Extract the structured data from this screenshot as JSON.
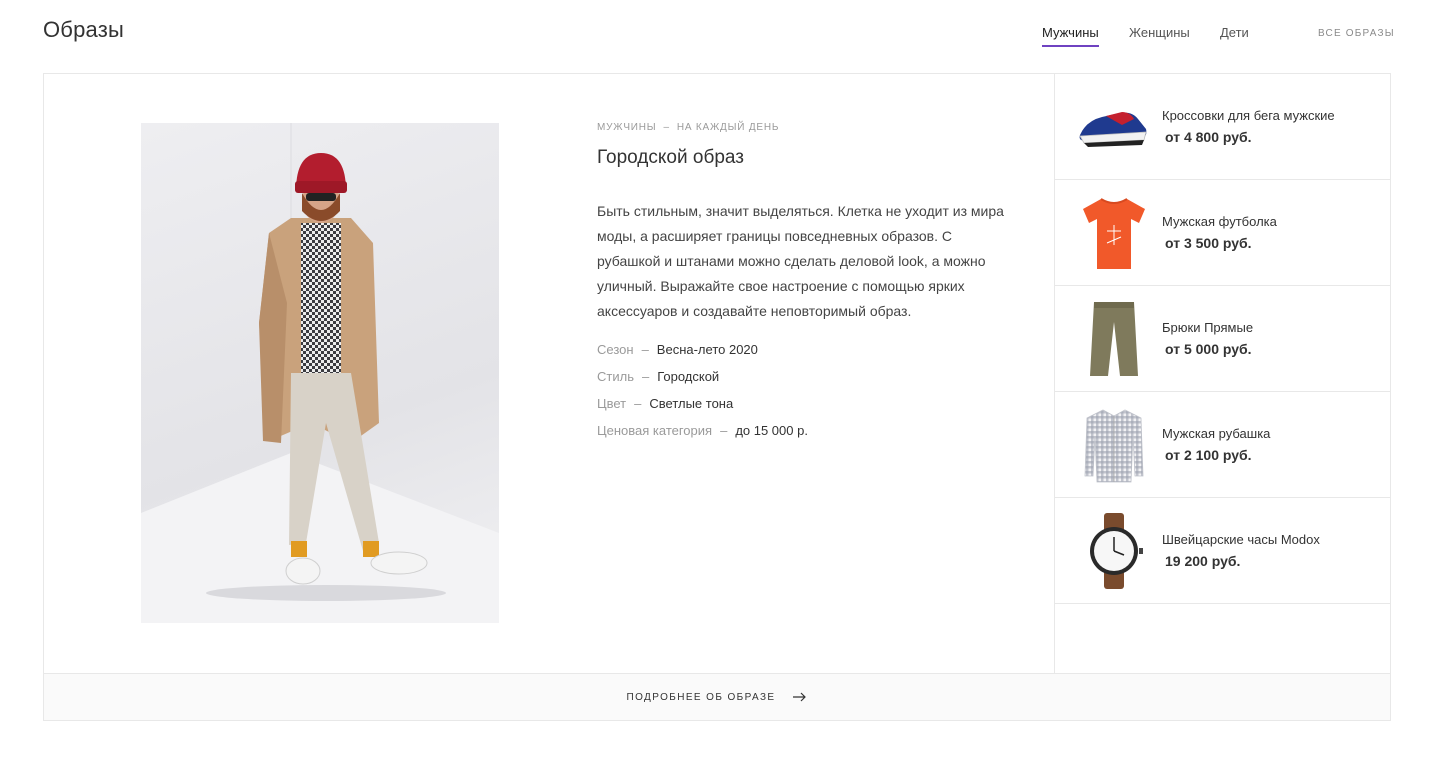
{
  "header": {
    "title": "Образы",
    "tabs": [
      {
        "label": "Мужчины",
        "active": true
      },
      {
        "label": "Женщины",
        "active": false
      },
      {
        "label": "Дети",
        "active": false
      }
    ],
    "all_looks_label": "ВСЕ ОБРАЗЫ",
    "accent_color": "#6f42c1"
  },
  "look": {
    "breadcrumb": {
      "category": "МУЖЧИНЫ",
      "separator": "–",
      "subcategory": "НА КАЖДЫЙ ДЕНЬ"
    },
    "title": "Городской образ",
    "description": "Быть стильным, значит выделяться. Клетка не уходит из мира моды, а расширяет границы повседневных образов. С рубашкой и штанами можно сделать деловой look, а можно уличный. Выражайте свое настроение с помощью ярких аксессуаров и создавайте неповторимый образ.",
    "properties": [
      {
        "label": "Сезон",
        "separator": "–",
        "value": "Весна-лето 2020"
      },
      {
        "label": "Стиль",
        "separator": "–",
        "value": "Городской"
      },
      {
        "label": "Цвет",
        "separator": "–",
        "value": "Светлые тона"
      },
      {
        "label": "Ценовая категория",
        "separator": "–",
        "value": "до 15 000 р."
      }
    ],
    "photo_icon": "model-photo"
  },
  "products": [
    {
      "name": "Кроссовки для бега мужские",
      "price": "от 4 800 руб.",
      "icon": "sneakers-icon"
    },
    {
      "name": "Мужская футболка",
      "price": "от 3 500 руб.",
      "icon": "tshirt-icon"
    },
    {
      "name": "Брюки Прямые",
      "price": "от 5 000 руб.",
      "icon": "trousers-icon"
    },
    {
      "name": "Мужская рубашка",
      "price": "от 2 100 руб.",
      "icon": "shirt-icon"
    },
    {
      "name": "Швейцарские часы Modox",
      "price": "19 200 руб.",
      "icon": "watch-icon"
    }
  ],
  "footer": {
    "more_label": "ПОДРОБНЕЕ ОБ ОБРАЗЕ",
    "arrow_icon": "arrow-right-icon"
  }
}
